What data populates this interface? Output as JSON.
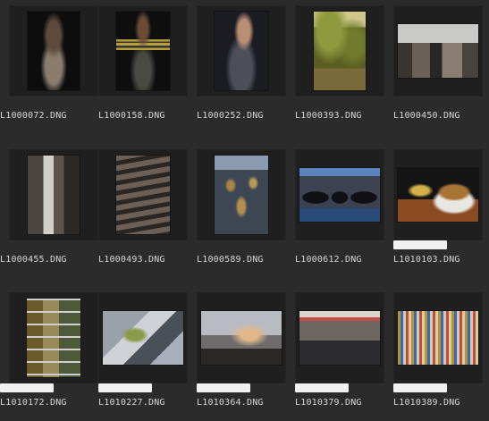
{
  "thumbnails": [
    {
      "filename": "L1000072.DNG",
      "tag": false
    },
    {
      "filename": "L1000158.DNG",
      "tag": false
    },
    {
      "filename": "L1000252.DNG",
      "tag": false
    },
    {
      "filename": "L1000393.DNG",
      "tag": false
    },
    {
      "filename": "L1000450.DNG",
      "tag": false
    },
    {
      "filename": "L1000455.DNG",
      "tag": false
    },
    {
      "filename": "L1000493.DNG",
      "tag": false
    },
    {
      "filename": "L1000589.DNG",
      "tag": false
    },
    {
      "filename": "L1000612.DNG",
      "tag": false
    },
    {
      "filename": "L1010103.DNG",
      "tag": true
    },
    {
      "filename": "L1010172.DNG",
      "tag": true
    },
    {
      "filename": "L1010227.DNG",
      "tag": true
    },
    {
      "filename": "L1010364.DNG",
      "tag": true
    },
    {
      "filename": "L1010379.DNG",
      "tag": true
    },
    {
      "filename": "L1010389.DNG",
      "tag": true
    }
  ]
}
